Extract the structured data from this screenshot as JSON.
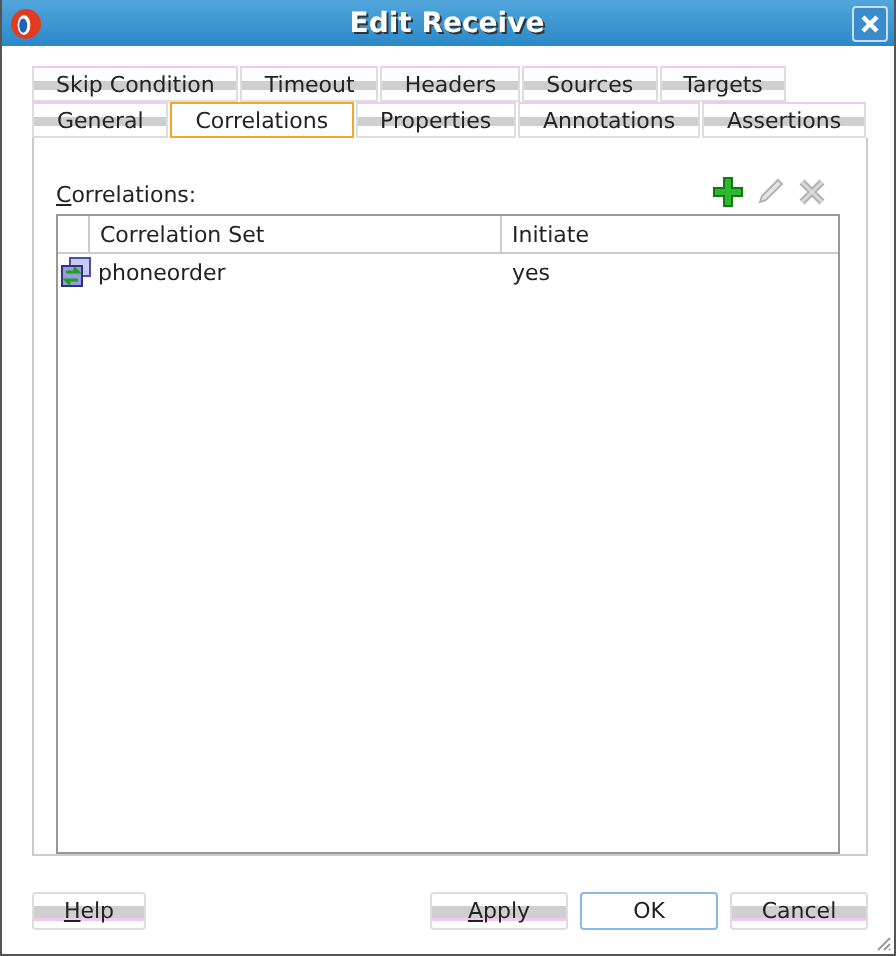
{
  "window": {
    "title": "Edit Receive"
  },
  "tab_rows": [
    [
      {
        "label": "Skip Condition",
        "selected": false
      },
      {
        "label": "Timeout",
        "selected": false
      },
      {
        "label": "Headers",
        "selected": false
      },
      {
        "label": "Sources",
        "selected": false
      },
      {
        "label": "Targets",
        "selected": false
      }
    ],
    [
      {
        "label": "General",
        "selected": false
      },
      {
        "label": "Correlations",
        "selected": true
      },
      {
        "label": "Properties",
        "selected": false
      },
      {
        "label": "Annotations",
        "selected": false
      },
      {
        "label": "Assertions",
        "selected": false
      }
    ]
  ],
  "correlations": {
    "label": "Correlations:",
    "label_mnemonic": true,
    "toolbar": [
      {
        "kind": "add",
        "disabled": false
      },
      {
        "kind": "edit",
        "disabled": true
      },
      {
        "kind": "delete",
        "disabled": true
      }
    ],
    "table": {
      "columns": [
        "Correlation Set",
        "Initiate"
      ],
      "rows": [
        {
          "cells": [
            "phoneorder",
            "yes"
          ],
          "selected": false
        }
      ]
    }
  },
  "buttons": [
    {
      "label": "Help",
      "mnemonic": true,
      "default": false
    },
    {
      "label": "Apply",
      "mnemonic": true,
      "default": false
    },
    {
      "label": "OK",
      "mnemonic": false,
      "default": true
    },
    {
      "label": "Cancel",
      "mnemonic": false,
      "default": false
    }
  ]
}
